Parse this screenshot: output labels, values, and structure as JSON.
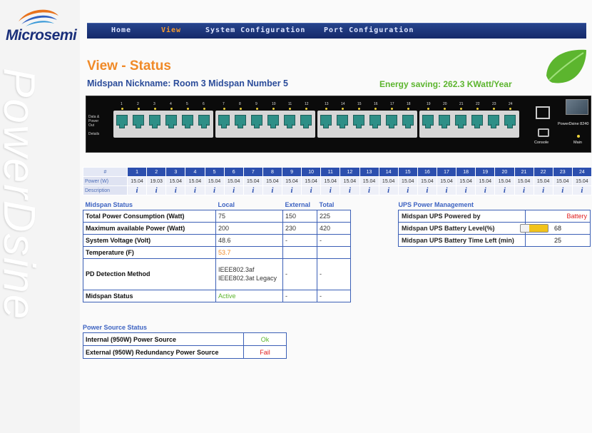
{
  "brand": {
    "logo_text": "Microsemi",
    "vertical_text": "PowerDsine"
  },
  "nav": {
    "items": [
      {
        "label": "Home"
      },
      {
        "label": "View"
      },
      {
        "label": "System Configuration"
      },
      {
        "label": "Port Configuration"
      }
    ],
    "active": "View"
  },
  "page": {
    "title": "View - Status",
    "midspan_nickname": "Midspan Nickname: Room 3 Midspan Number 5",
    "energy_saving": "Energy saving: 262.3 KWatt/Year"
  },
  "device": {
    "legend_lines": [
      "Data &",
      "Power",
      "Out",
      "Details"
    ],
    "console_label": "Console",
    "main_label": "Main",
    "model_label": "PowerDsine 8240"
  },
  "ports": {
    "header_label": "#",
    "power_label": "Power (W)",
    "description_label": "Description",
    "info_glyph": "i",
    "numbers": [
      "1",
      "2",
      "3",
      "4",
      "5",
      "6",
      "7",
      "8",
      "9",
      "10",
      "11",
      "12",
      "13",
      "14",
      "15",
      "16",
      "17",
      "18",
      "19",
      "20",
      "21",
      "22",
      "23",
      "24"
    ],
    "power": [
      "15.04",
      "19.03",
      "15.04",
      "15.04",
      "15.04",
      "15.04",
      "15.04",
      "15.04",
      "15.04",
      "15.04",
      "15.04",
      "15.04",
      "15.04",
      "15.04",
      "15.04",
      "15.04",
      "15.04",
      "15.04",
      "15.04",
      "15.04",
      "15.04",
      "15.04",
      "15.04",
      "15.04"
    ]
  },
  "midspan_status": {
    "section_title": "Midspan Status",
    "col_local": "Local",
    "col_external": "External",
    "col_total": "Total",
    "rows": [
      {
        "label": "Total Power Consumption (Watt)",
        "local": "75",
        "external": "150",
        "total": "225"
      },
      {
        "label": "Maximum available Power (Watt)",
        "local": "200",
        "external": "230",
        "total": "420"
      },
      {
        "label": "System Voltage (Volt)",
        "local": "48.6",
        "external": "-",
        "total": "-"
      },
      {
        "label": "Temperature (F)",
        "local": "53.7",
        "external": "",
        "total": ""
      },
      {
        "label": "PD Detection Method",
        "local": "IEEE802.3af IEEE802.3at Legacy",
        "external": "-",
        "total": "-"
      },
      {
        "label": "Midspan Status",
        "local": "Active",
        "external": "-",
        "total": "-"
      }
    ]
  },
  "ups": {
    "section_title": "UPS Power Management",
    "rows": [
      {
        "label": "Midspan UPS Powered by",
        "value": "Battery"
      },
      {
        "label": "Midspan UPS Battery Level(%)",
        "value": "68"
      },
      {
        "label": "Midspan UPS Battery Time Left (min)",
        "value": "25"
      }
    ],
    "battery_level_fraction": 0.68
  },
  "power_source": {
    "section_title": "Power Source Status",
    "rows": [
      {
        "label": "Internal (950W) Power Source",
        "status": "Ok"
      },
      {
        "label": "External (950W) Redundancy Power Source",
        "status": "Fail"
      }
    ]
  },
  "colors": {
    "accent_orange": "#f08a28",
    "nav_blue": "#1c357a",
    "ok_green": "#5cb52e",
    "fail_red": "#e02020",
    "battery_yellow": "#f2c31a"
  }
}
